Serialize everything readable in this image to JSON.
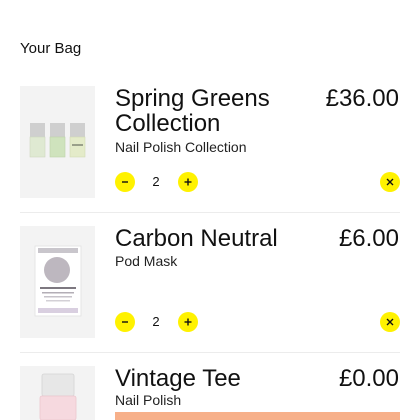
{
  "bag": {
    "title": "Your Bag"
  },
  "items": [
    {
      "name": "Spring Greens Collection",
      "price": "£36.00",
      "subtitle": "Nail Polish Collection",
      "quantity": "2",
      "image_icon": "nail-polish-trio-icon"
    },
    {
      "name": "Carbon Neutral",
      "price": "£6.00",
      "subtitle": "Pod Mask",
      "quantity": "2",
      "image_icon": "pod-mask-box-icon"
    },
    {
      "name": "Vintage Tee",
      "price": "£0.00",
      "subtitle": "Nail Polish",
      "image_icon": "nail-polish-bottle-icon"
    }
  ],
  "colors": {
    "accent_yellow": "#fff200",
    "promo_peach": "#f7b08a",
    "text": "#111111"
  }
}
